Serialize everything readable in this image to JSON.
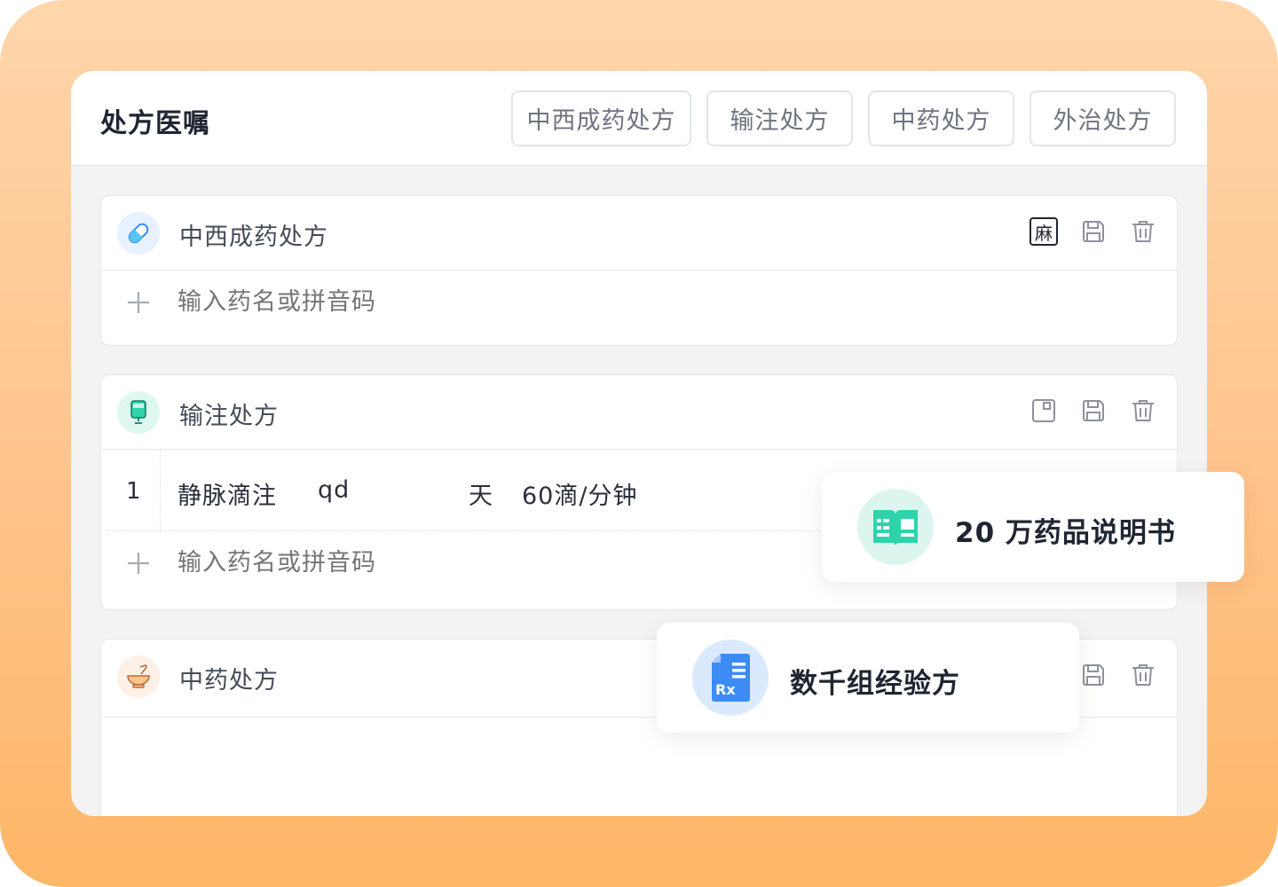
{
  "panel": {
    "title": "处方医嘱",
    "tabs": [
      {
        "label": "中西成药处方"
      },
      {
        "label": "输注处方"
      },
      {
        "label": "中药处方"
      },
      {
        "label": "外治处方"
      }
    ]
  },
  "cards": {
    "western": {
      "title": "中西成药处方",
      "badge": "麻",
      "add_placeholder": "输入药名或拼音码"
    },
    "infusion": {
      "title": "输注处方",
      "row": {
        "index": "1",
        "route": "静脉滴注",
        "frequency": "qd",
        "unit": "天",
        "speed": "60滴/分钟"
      },
      "add_placeholder": "输入药名或拼音码"
    },
    "herbal": {
      "title": "中药处方"
    }
  },
  "floating": {
    "drug_manual": "20 万药品说明书",
    "prescriptions": "数千组经验方",
    "rx_label": "Rx"
  },
  "colors": {
    "pill_icon_bg": "#e7f1ff",
    "infusion_icon_bg": "#def8f1",
    "herbal_icon_bg": "#fdf0e7",
    "book_icon_bg": "#dcf6ef",
    "book_icon": "#2fd3a9",
    "rx_icon_bg": "#dbe9fd",
    "rx_icon": "#3d8cf5"
  }
}
